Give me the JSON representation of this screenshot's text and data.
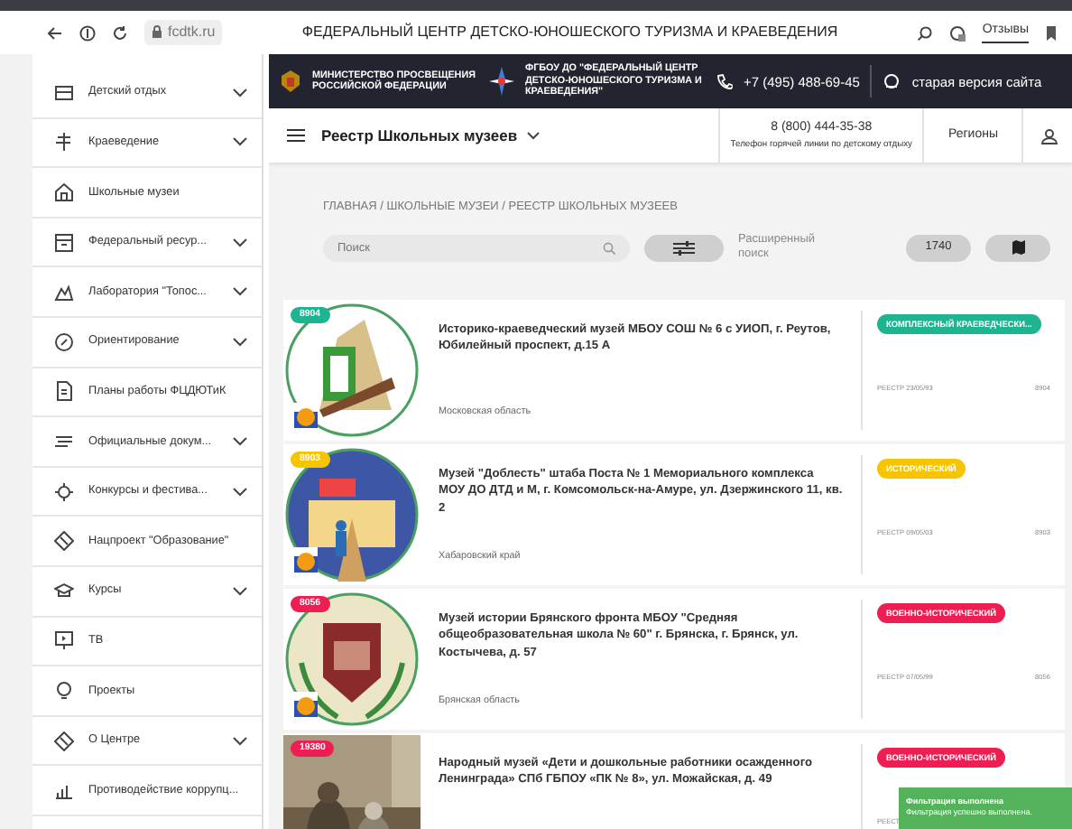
{
  "browser": {
    "url": "fcdtk.ru",
    "title": "ФЕДЕРАЛЬНЫЙ ЦЕНТР ДЕТСКО-ЮНОШЕСКОГО ТУРИЗМА И КРАЕВЕДЕНИЯ",
    "feedback": "Отзывы"
  },
  "sidebar": {
    "items": [
      {
        "label": "Детский отдых",
        "expandable": true
      },
      {
        "label": "Краеведение",
        "expandable": true
      },
      {
        "label": "Школьные музеи",
        "expandable": false
      },
      {
        "label": "Федеральный ресур...",
        "expandable": true
      },
      {
        "label": "Лаборатория \"Топос...",
        "expandable": true
      },
      {
        "label": "Ориентирование",
        "expandable": true
      },
      {
        "label": "Планы работы ФЦДЮТиК",
        "expandable": false
      },
      {
        "label": "Официальные докум...",
        "expandable": true
      },
      {
        "label": "Конкурсы и фестива...",
        "expandable": true
      },
      {
        "label": "Нацпроект \"Образование\"",
        "expandable": false
      },
      {
        "label": "Курсы",
        "expandable": true
      },
      {
        "label": "ТВ",
        "expandable": false
      },
      {
        "label": "Проекты",
        "expandable": false
      },
      {
        "label": "О Центре",
        "expandable": true
      },
      {
        "label": "Противодействие коррупц...",
        "expandable": false
      }
    ]
  },
  "header": {
    "ministry": "МИНИСТЕРСТВО ПРОСВЕЩЕНИЯ РОССИЙСКОЙ ФЕДЕРАЦИИ",
    "org": "ФГБОУ ДО \"ФЕДЕРАЛЬНЫЙ ЦЕНТР ДЕТСКО-ЮНОШЕСКОГО ТУРИЗМА И КРАЕВЕДЕНИЯ\"",
    "phone": "+7 (495) 488-69-45",
    "old_site": "старая версия сайта"
  },
  "nav": {
    "section": "Реестр Школьных музеев",
    "hotline": "8 (800) 444-35-38",
    "hotline_caption": "Телефон горячей линии по детскому отдыху",
    "regions": "Регионы"
  },
  "breadcrumb": "ГЛАВНАЯ / ШКОЛЬНЫЕ МУЗЕИ / РЕЕСТР ШКОЛЬНЫХ МУЗЕЕВ",
  "search": {
    "placeholder": "Поиск",
    "advanced": "Расширенный поиск",
    "count": "1740"
  },
  "museums": [
    {
      "number": "8904",
      "title": "Историко-краеведческий музей МБОУ СОШ № 6 с УИОП, г. Реутов, Юбилейный проспект, д.15 А",
      "region": "Московская область",
      "tag": "КОМПЛЕКСНЫЙ КРАЕВЕДЧЕСКИ...",
      "color": "#1db48f",
      "registry": "РЕЕСТР 23/05/93",
      "code": "8904"
    },
    {
      "number": "8903",
      "title": "Музей \"Доблесть\" штаба Поста № 1 Мемориального комплекса МОУ ДО ДТД и М, г. Комсомольск-на-Амуре, ул. Дзержинского 11, кв. 2",
      "region": "Хабаровский край",
      "tag": "ИСТОРИЧЕСКИЙ",
      "color": "#f7c500",
      "registry": "РЕЕСТР 09/05/03",
      "code": "8903"
    },
    {
      "number": "8056",
      "title": "Музей истории Брянского фронта МБОУ \"Средняя общеобразовательная школа № 60\" г. Брянска, г. Брянск, ул. Костычева, д. 57",
      "region": "Брянская область",
      "tag": "ВОЕННО-ИСТОРИЧЕСКИЙ",
      "color": "#ee1d52",
      "registry": "РЕЕСТР 07/05/99",
      "code": "8056"
    },
    {
      "number": "19380",
      "title": "Народный музей «Дети и дошкольные работники осажденного Ленинграда» СПб ГБПОУ «ПК № 8», ул. Можайская, д. 49",
      "tag": "ВОЕННО-ИСТОРИЧЕСКИЙ",
      "color": "#ee1d52",
      "registry": "РЕЕСТ"
    }
  ],
  "toast": {
    "title": "Фильтрация выполнена",
    "text": "Фильтрация успешно выполнена."
  }
}
